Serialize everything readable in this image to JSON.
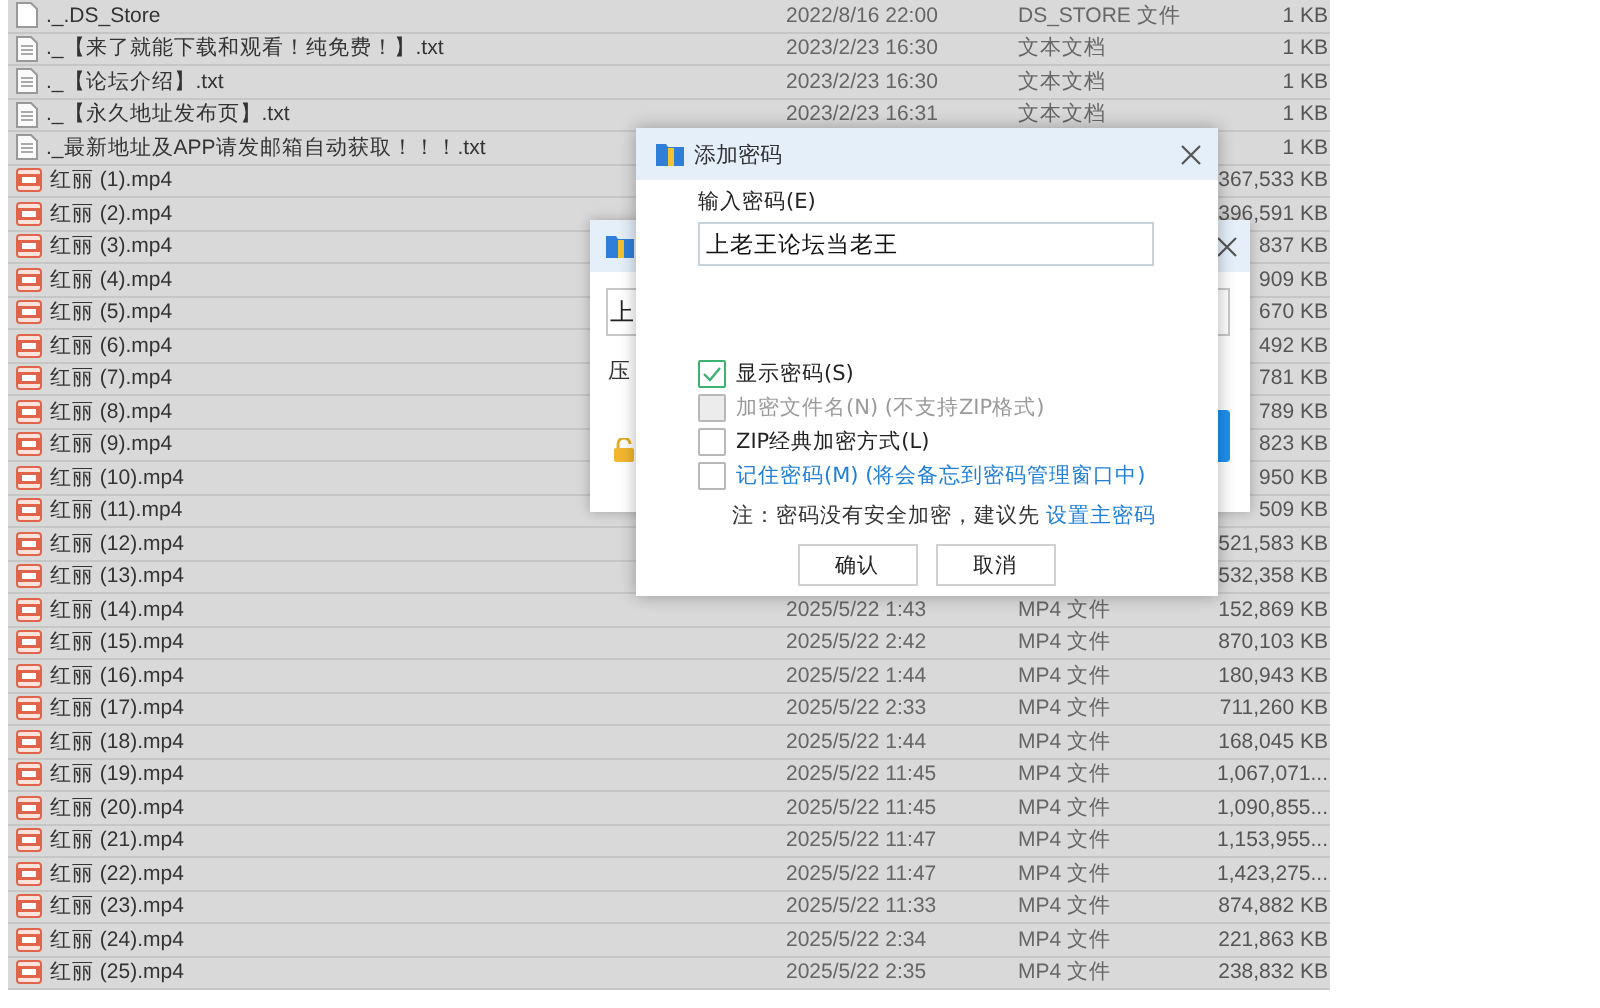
{
  "files": [
    {
      "kind": "blank",
      "name": "._.DS_Store",
      "date": "2022/8/16 22:00",
      "type": "DS_STORE 文件",
      "size": "1 KB"
    },
    {
      "kind": "txt",
      "name": "._【来了就能下载和观看！纯免费！】.txt",
      "date": "2023/2/23 16:30",
      "type": "文本文档",
      "size": "1 KB"
    },
    {
      "kind": "txt",
      "name": "._【论坛介绍】.txt",
      "date": "2023/2/23 16:30",
      "type": "文本文档",
      "size": "1 KB"
    },
    {
      "kind": "txt",
      "name": "._【永久地址发布页】.txt",
      "date": "2023/2/23 16:31",
      "type": "文本文档",
      "size": "1 KB"
    },
    {
      "kind": "txt",
      "name": "._最新地址及APP请发邮箱自动获取！！！.txt",
      "size": "1 KB"
    },
    {
      "kind": "mp4",
      "name": "红丽 (1).mp4",
      "size": "367,533 KB"
    },
    {
      "kind": "mp4",
      "name": "红丽 (2).mp4",
      "size": "396,591 KB"
    },
    {
      "kind": "mp4",
      "name": "红丽 (3).mp4",
      "size": "837 KB"
    },
    {
      "kind": "mp4",
      "name": "红丽 (4).mp4",
      "size": "909 KB"
    },
    {
      "kind": "mp4",
      "name": "红丽 (5).mp4",
      "size": "670 KB"
    },
    {
      "kind": "mp4",
      "name": "红丽 (6).mp4",
      "size": "492 KB"
    },
    {
      "kind": "mp4",
      "name": "红丽 (7).mp4",
      "size": "781 KB"
    },
    {
      "kind": "mp4",
      "name": "红丽 (8).mp4",
      "size": "789 KB"
    },
    {
      "kind": "mp4",
      "name": "红丽 (9).mp4",
      "size": "823 KB"
    },
    {
      "kind": "mp4",
      "name": "红丽 (10).mp4",
      "size": "950 KB"
    },
    {
      "kind": "mp4",
      "name": "红丽 (11).mp4",
      "size": "509 KB"
    },
    {
      "kind": "mp4",
      "name": "红丽 (12).mp4",
      "size": "521,583 KB"
    },
    {
      "kind": "mp4",
      "name": "红丽 (13).mp4",
      "size": "532,358 KB"
    },
    {
      "kind": "mp4",
      "name": "红丽 (14).mp4",
      "date": "2025/5/22 1:43",
      "type": "MP4 文件",
      "size": "152,869 KB"
    },
    {
      "kind": "mp4",
      "name": "红丽 (15).mp4",
      "date": "2025/5/22 2:42",
      "type": "MP4 文件",
      "size": "870,103 KB"
    },
    {
      "kind": "mp4",
      "name": "红丽 (16).mp4",
      "date": "2025/5/22 1:44",
      "type": "MP4 文件",
      "size": "180,943 KB"
    },
    {
      "kind": "mp4",
      "name": "红丽 (17).mp4",
      "date": "2025/5/22 2:33",
      "type": "MP4 文件",
      "size": "711,260 KB"
    },
    {
      "kind": "mp4",
      "name": "红丽 (18).mp4",
      "date": "2025/5/22 1:44",
      "type": "MP4 文件",
      "size": "168,045 KB"
    },
    {
      "kind": "mp4",
      "name": "红丽 (19).mp4",
      "date": "2025/5/22 11:45",
      "type": "MP4 文件",
      "size": "1,067,071..."
    },
    {
      "kind": "mp4",
      "name": "红丽 (20).mp4",
      "date": "2025/5/22 11:45",
      "type": "MP4 文件",
      "size": "1,090,855..."
    },
    {
      "kind": "mp4",
      "name": "红丽 (21).mp4",
      "date": "2025/5/22 11:47",
      "type": "MP4 文件",
      "size": "1,153,955..."
    },
    {
      "kind": "mp4",
      "name": "红丽 (22).mp4",
      "date": "2025/5/22 11:47",
      "type": "MP4 文件",
      "size": "1,423,275..."
    },
    {
      "kind": "mp4",
      "name": "红丽 (23).mp4",
      "date": "2025/5/22 11:33",
      "type": "MP4 文件",
      "size": "874,882 KB"
    },
    {
      "kind": "mp4",
      "name": "红丽 (24).mp4",
      "date": "2025/5/22 2:34",
      "type": "MP4 文件",
      "size": "221,863 KB"
    },
    {
      "kind": "mp4",
      "name": "红丽 (25).mp4",
      "date": "2025/5/22 2:35",
      "type": "MP4 文件",
      "size": "238,832 KB"
    }
  ],
  "back_dialog": {
    "field_value": "上",
    "label": "压"
  },
  "dialog": {
    "title": "添加密码",
    "password_label": "输入密码(E)",
    "password_value": "上老王论坛当老王",
    "options": [
      {
        "kind": "plain",
        "label": "显示密码(S)",
        "checked": true,
        "disabled": false
      },
      {
        "kind": "plain",
        "label": "加密文件名(N) (不支持ZIP格式)",
        "checked": false,
        "disabled": true
      },
      {
        "kind": "plain",
        "label": "ZIP经典加密方式(L)",
        "checked": false,
        "disabled": false
      },
      {
        "kind": "link",
        "label": "记住密码(M) (将会备忘到密码管理窗口中)",
        "checked": false,
        "disabled": false
      }
    ],
    "note": "注：密码没有安全加密，建议先",
    "note_link": "设置主密码",
    "buttons": [
      "确认",
      "取消"
    ]
  }
}
